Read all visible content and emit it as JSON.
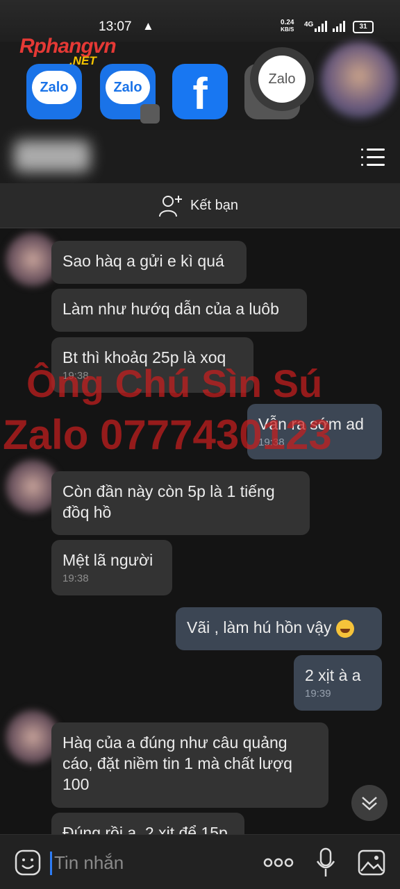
{
  "status_bar": {
    "time": "13:07",
    "net_speed_value": "0.24",
    "net_speed_unit": "KB/S",
    "network": "4G",
    "battery": "31"
  },
  "overlay_logo": {
    "brand": "Rphangvn",
    "suffix": ".NET"
  },
  "app_strip": {
    "zalo_label": "Zalo",
    "zalo2_label": "Zalo",
    "facebook_label": "f",
    "zalo_bubble_label": "Zalo"
  },
  "header": {
    "add_friend_label": "Kết bạn"
  },
  "messages": [
    {
      "dir": "in",
      "text": "Sao hàq a gửi e kì quá",
      "time": ""
    },
    {
      "dir": "in",
      "text": "Làm như hướq dẫn của a luôb",
      "time": ""
    },
    {
      "dir": "in",
      "text": "Bt thì khoảq 25p là xoq",
      "time": "19:38"
    },
    {
      "dir": "out",
      "text": "Vẫn ra sớm ad",
      "time": "19:38"
    },
    {
      "dir": "in",
      "text": "Còn đần này còn 5p là 1 tiếng đồq hồ",
      "time": ""
    },
    {
      "dir": "in",
      "text": "Mệt lã người",
      "time": "19:38"
    },
    {
      "dir": "out",
      "text": "Vãi , làm hú hồn vậy",
      "time": ""
    },
    {
      "dir": "out",
      "text": "2 xịt à a",
      "time": "19:39"
    },
    {
      "dir": "in",
      "text": "Hàq của a đúng như câu quảng cáo, đặt niềm tin 1 mà chất lượq 100",
      "time": ""
    },
    {
      "dir": "in",
      "text": "Đúng rồi a. 2 xịt để 15p",
      "time": ""
    }
  ],
  "watermark": {
    "line1": "Ông Chú Sìn Sú",
    "line2": "Zalo 0777430123"
  },
  "input": {
    "placeholder": "Tin nhắn"
  },
  "colors": {
    "background": "#141414",
    "incoming_bubble": "#333333",
    "outgoing_bubble": "#3c4654",
    "watermark": "#c81e1e",
    "accent": "#2d7cf6"
  }
}
